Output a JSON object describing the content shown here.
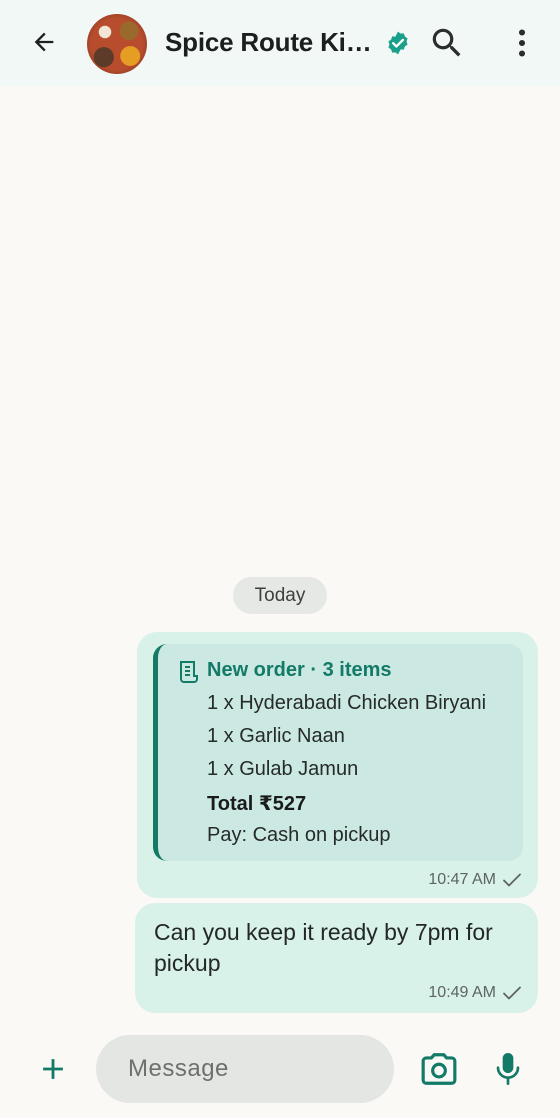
{
  "header": {
    "contact_name": "Spice Route Kit…",
    "verified": true
  },
  "conversation": {
    "date_label": "Today",
    "messages": [
      {
        "type": "order",
        "title": "New order · 3 items",
        "items": [
          "1 x Hyderabadi Chicken Biryani",
          "1 x Garlic Naan",
          "1 x Gulab Jamun"
        ],
        "total": "Total ₹527",
        "payment": "Pay: Cash on pickup",
        "time": "10:47 AM",
        "status": "sent"
      },
      {
        "type": "text",
        "text": "Can you keep it ready by 7pm for pickup",
        "time": "10:49 AM",
        "status": "sent"
      }
    ]
  },
  "composer": {
    "placeholder": "Message"
  },
  "icons": {
    "back": "arrow-left-icon",
    "verified": "verified-badge-icon",
    "search": "search-icon",
    "menu": "more-vert-icon",
    "receipt": "receipt-icon",
    "check": "check-icon",
    "plus": "plus-icon",
    "camera": "camera-icon",
    "mic": "mic-icon"
  },
  "colors": {
    "accent": "#137a68",
    "verified": "#1aa08a",
    "header_bg": "#f1f8f5",
    "bubble_bg": "#d8f2ea",
    "order_card_bg": "#cbe9e2",
    "chat_bg": "#fbf9f6"
  }
}
